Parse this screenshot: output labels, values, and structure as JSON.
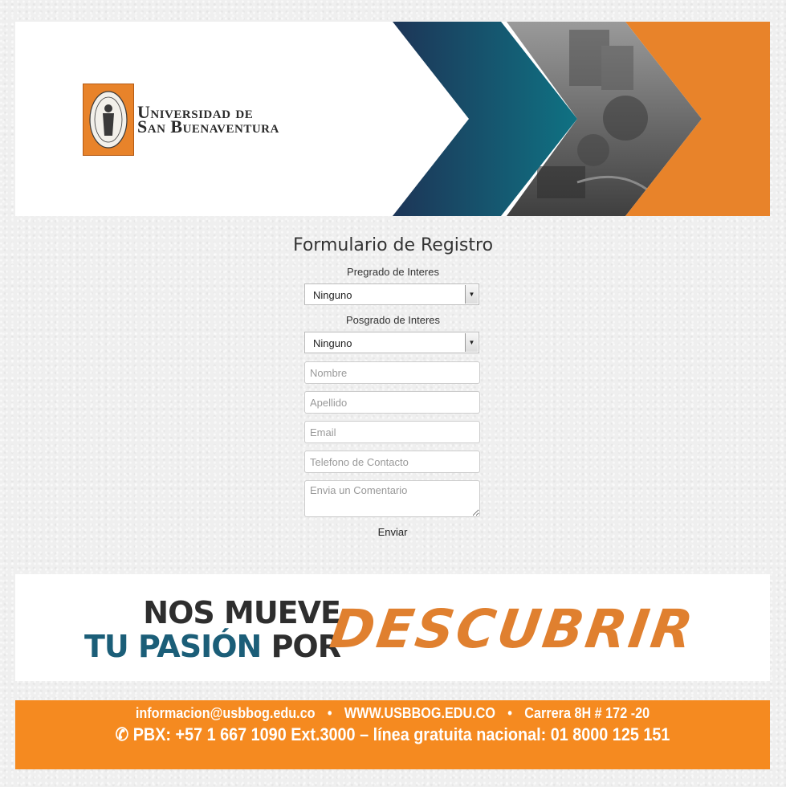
{
  "header": {
    "university_line1": "Universidad de",
    "university_line2": "San Buenaventura",
    "seal_icon": "university-seal-icon",
    "campus_photo_icon": "campus-photo",
    "colors": {
      "navy": "#1d3a5c",
      "teal": "#0e6b7e",
      "orange": "#e8832a"
    }
  },
  "form": {
    "title": "Formulario de Registro",
    "pregrado_label": "Pregrado de Interes",
    "pregrado_selected": "Ninguno",
    "posgrado_label": "Posgrado de Interes",
    "posgrado_selected": "Ninguno",
    "nombre_placeholder": "Nombre",
    "apellido_placeholder": "Apellido",
    "email_placeholder": "Email",
    "telefono_placeholder": "Telefono de Contacto",
    "comentario_placeholder": "Envia un Comentario",
    "submit_label": "Enviar"
  },
  "slogan": {
    "line1": "NOS MUEVE",
    "line2_part1": "TU PASIÓN",
    "line2_part2": "POR",
    "highlight": "DESCUBRIR"
  },
  "footer": {
    "email": "informacion@usbbog.edu.co",
    "website": "WWW.USBBOG.EDU.CO",
    "address": "Carrera 8H # 172 -20",
    "separator": "•",
    "phone_icon": "phone-icon",
    "phone_line": "PBX: +57 1 667 1090 Ext.3000 – línea gratuita nacional: 01 8000 125 151",
    "background_color": "#f58a20"
  }
}
